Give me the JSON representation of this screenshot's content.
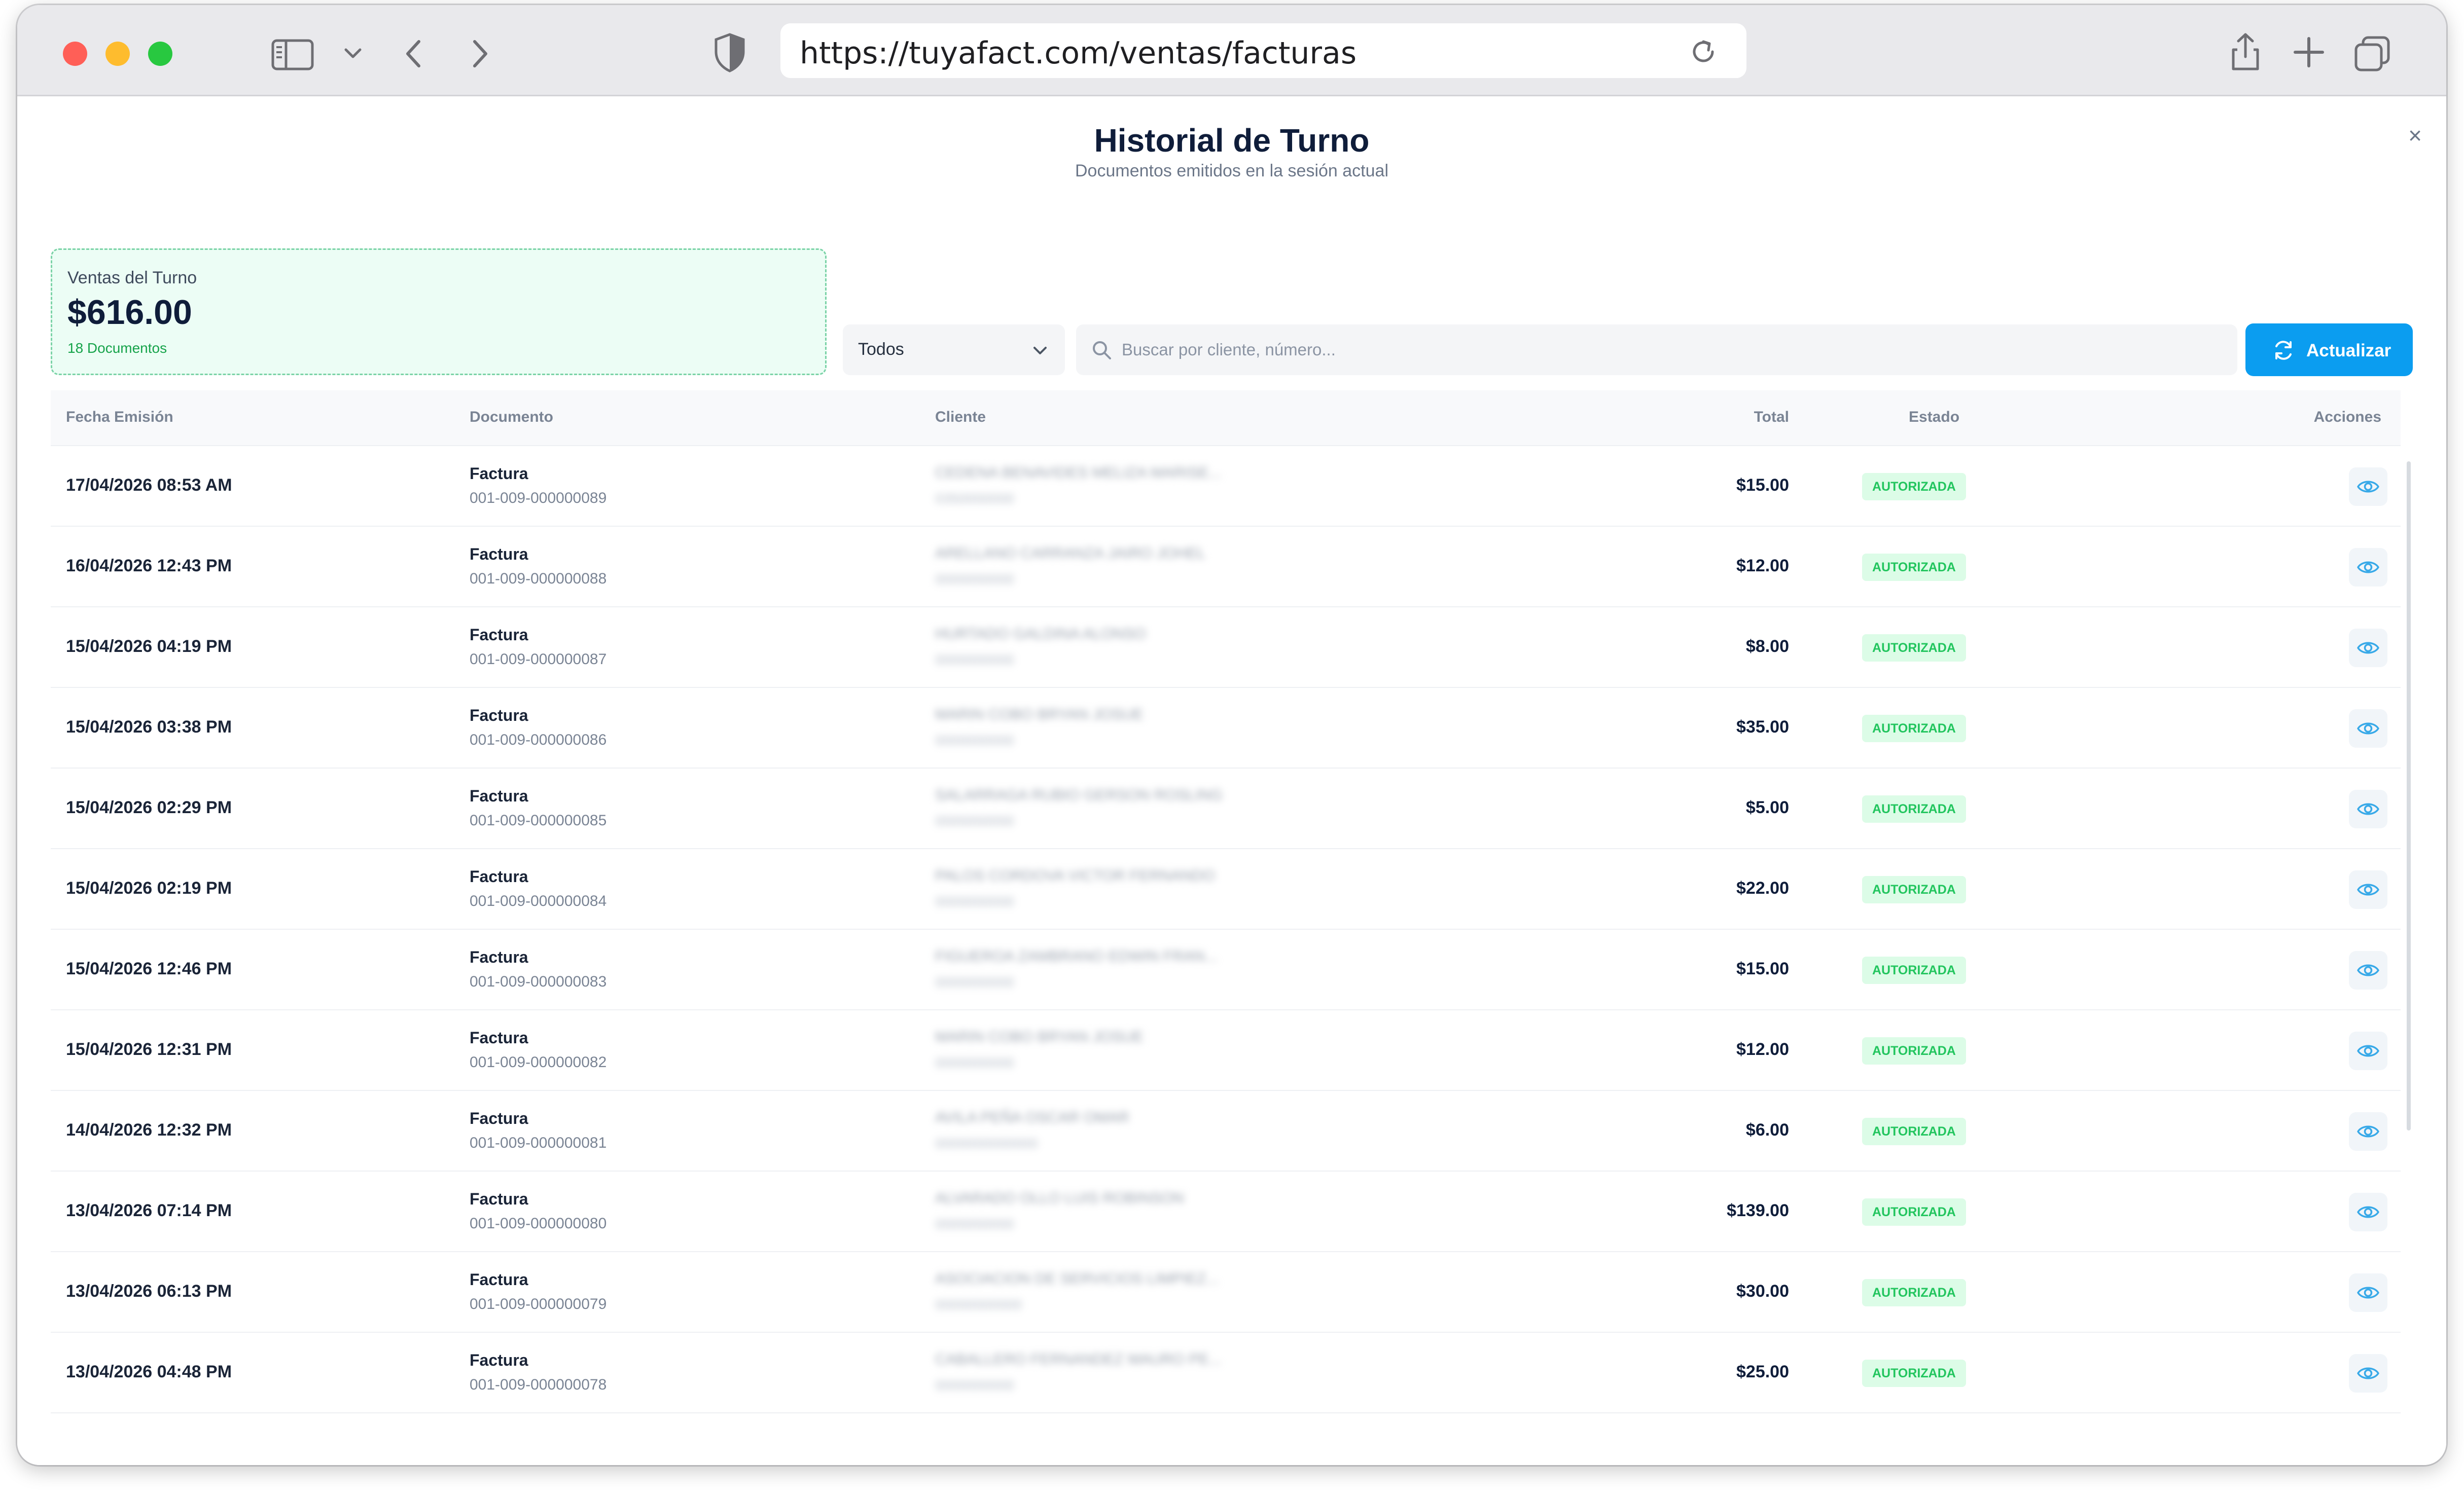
{
  "browser": {
    "url": "https://tuyafact.com/ventas/facturas"
  },
  "modal": {
    "title": "Historial de Turno",
    "subtitle": "Documentos emitidos en la sesión actual",
    "close_label": "×"
  },
  "summary": {
    "label": "Ventas del Turno",
    "amount": "$616.00",
    "count": "18 Documentos"
  },
  "filters": {
    "selected": "Todos",
    "search_placeholder": "Buscar por cliente, número...",
    "refresh_label": "Actualizar"
  },
  "table": {
    "headers": {
      "date": "Fecha Emisión",
      "document": "Documento",
      "client": "Cliente",
      "total": "Total",
      "status": "Estado",
      "actions": "Acciones"
    },
    "rows": [
      {
        "date": "17/04/2026 08:53 AM",
        "doc_type": "Factura",
        "doc_number": "001-009-000000089",
        "client_name": "CEDENA BENAVIDES MELIZA MARISE...",
        "client_id": "0350000000",
        "total": "$15.00",
        "status": "AUTORIZADA"
      },
      {
        "date": "16/04/2026 12:43 PM",
        "doc_type": "Factura",
        "doc_number": "001-009-000000088",
        "client_name": "ARELLANO CARRANZA JAIRO JOHEL",
        "client_id": "0000000000",
        "total": "$12.00",
        "status": "AUTORIZADA"
      },
      {
        "date": "15/04/2026 04:19 PM",
        "doc_type": "Factura",
        "doc_number": "001-009-000000087",
        "client_name": "HURTADO GALDINA ALONSO",
        "client_id": "0000000000",
        "total": "$8.00",
        "status": "AUTORIZADA"
      },
      {
        "date": "15/04/2026 03:38 PM",
        "doc_type": "Factura",
        "doc_number": "001-009-000000086",
        "client_name": "MARIN COBO BRYAN JOSUE",
        "client_id": "0000000000",
        "total": "$35.00",
        "status": "AUTORIZADA"
      },
      {
        "date": "15/04/2026 02:29 PM",
        "doc_type": "Factura",
        "doc_number": "001-009-000000085",
        "client_name": "SALARRAGA RUBIO GERSON ROSLING",
        "client_id": "0000000000",
        "total": "$5.00",
        "status": "AUTORIZADA"
      },
      {
        "date": "15/04/2026 02:19 PM",
        "doc_type": "Factura",
        "doc_number": "001-009-000000084",
        "client_name": "PALOS CORDOVA VICTOR FERNANDO",
        "client_id": "0000000000",
        "total": "$22.00",
        "status": "AUTORIZADA"
      },
      {
        "date": "15/04/2026 12:46 PM",
        "doc_type": "Factura",
        "doc_number": "001-009-000000083",
        "client_name": "FIGUEROA ZAMBRANO EDWIN FRAN...",
        "client_id": "0000000000",
        "total": "$15.00",
        "status": "AUTORIZADA"
      },
      {
        "date": "15/04/2026 12:31 PM",
        "doc_type": "Factura",
        "doc_number": "001-009-000000082",
        "client_name": "MARIN COBO BRYAN JOSUE",
        "client_id": "0000000000",
        "total": "$12.00",
        "status": "AUTORIZADA"
      },
      {
        "date": "14/04/2026 12:32 PM",
        "doc_type": "Factura",
        "doc_number": "001-009-000000081",
        "client_name": "AVILA PEÑA OSCAR OMAR",
        "client_id": "0000000000000",
        "total": "$6.00",
        "status": "AUTORIZADA"
      },
      {
        "date": "13/04/2026 07:14 PM",
        "doc_type": "Factura",
        "doc_number": "001-009-000000080",
        "client_name": "ALVARADO OLLO LUIS ROBINSON",
        "client_id": "0000000000",
        "total": "$139.00",
        "status": "AUTORIZADA"
      },
      {
        "date": "13/04/2026 06:13 PM",
        "doc_type": "Factura",
        "doc_number": "001-009-000000079",
        "client_name": "ASOCIACION DE SERVICIOS LIMPIEZ...",
        "client_id": "00000000000",
        "total": "$30.00",
        "status": "AUTORIZADA"
      },
      {
        "date": "13/04/2026 04:48 PM",
        "doc_type": "Factura",
        "doc_number": "001-009-000000078",
        "client_name": "CABALLERO FERNANDEZ MAURO PE...",
        "client_id": "0000000000",
        "total": "$25.00",
        "status": "AUTORIZADA"
      }
    ]
  },
  "colors": {
    "accent": "#0b9df0",
    "success": "#22c55e",
    "card_bg": "#ecfdf5"
  }
}
